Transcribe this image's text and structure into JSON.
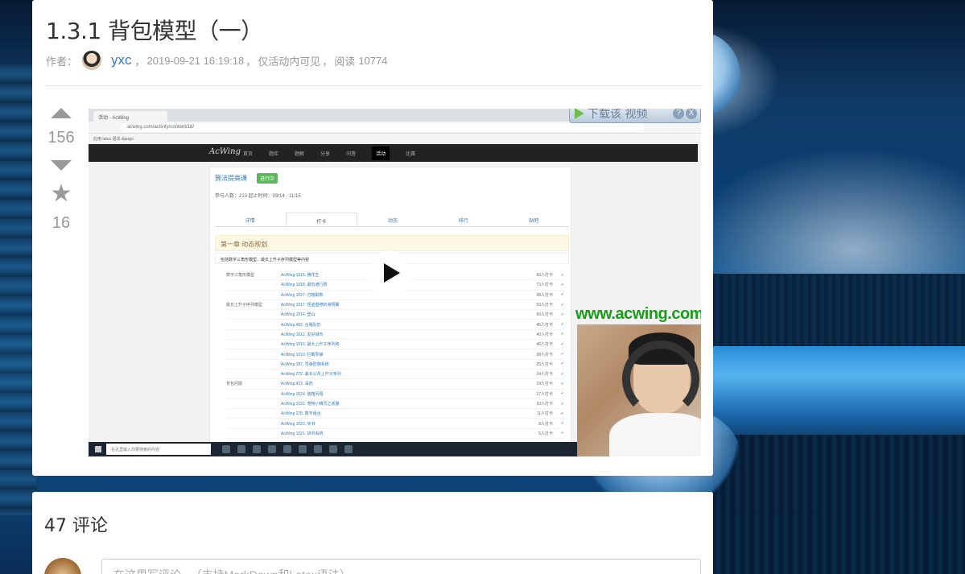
{
  "article": {
    "title": "1.3.1 背包模型（一）",
    "author_label": "作者：",
    "author_name": "yxc",
    "date": "2019-09-21 16:19:18",
    "visibility": "仅活动内可见",
    "read_label": "阅读",
    "read_count": "10774"
  },
  "votes": {
    "up_count": "156",
    "star_count": "16"
  },
  "video": {
    "browser_tab": "活动 - AcWing",
    "url": "acwing.com/activity/content/16/",
    "bookmarks": "应用   latex 语法   django",
    "site_logo": "AcWing",
    "nav_items": [
      "首页",
      "题库",
      "题解",
      "分享",
      "问答",
      "活动",
      "比赛"
    ],
    "nav_active": "活动",
    "course_title": "算法提高课",
    "course_status": "进行中",
    "course_info": "参与人数：213   起止时间：09/14 - 11/15",
    "tabs": [
      "详情",
      "打卡",
      "动态",
      "排行",
      "贴吧"
    ],
    "active_tab": "打卡",
    "chapter": "第一章 动态规划",
    "chapter_desc": "包括数字三角形模型、最长上升子序列模型等内容",
    "rows": [
      {
        "cat": "数字三角形模型",
        "name": "AcWing 1015. 摘花生",
        "cnt": "60人打卡"
      },
      {
        "cat": "",
        "name": "AcWing 1018. 最低通行费",
        "cnt": "73人打卡"
      },
      {
        "cat": "",
        "name": "AcWing 1027. 方格取数",
        "cnt": "58人打卡"
      },
      {
        "cat": "最长上升子序列模型",
        "name": "AcWing 1017. 怪盗基德的滑翔翼",
        "cnt": "53人打卡"
      },
      {
        "cat": "",
        "name": "AcWing 1014. 登山",
        "cnt": "50人打卡"
      },
      {
        "cat": "",
        "name": "AcWing 482. 合唱队形",
        "cnt": "45人打卡"
      },
      {
        "cat": "",
        "name": "AcWing 1012. 友好城市",
        "cnt": "40人打卡"
      },
      {
        "cat": "",
        "name": "AcWing 1016. 最大上升子序列和",
        "cnt": "46人打卡"
      },
      {
        "cat": "",
        "name": "AcWing 1010. 拦截导弹",
        "cnt": "38人打卡"
      },
      {
        "cat": "",
        "name": "AcWing 187. 导弹防御系统",
        "cnt": "25人打卡"
      },
      {
        "cat": "",
        "name": "AcWing 272. 最长公共上升子序列",
        "cnt": "24人打卡"
      },
      {
        "cat": "背包问题",
        "name": "AcWing 423. 采药",
        "cnt": "19人打卡"
      },
      {
        "cat": "",
        "name": "AcWing 1024. 装箱问题",
        "cnt": "17人打卡"
      },
      {
        "cat": "",
        "name": "AcWing 1022. 宠物小精灵之收服",
        "cnt": "10人打卡"
      },
      {
        "cat": "",
        "name": "AcWing 278. 数字组合",
        "cnt": "11人打卡"
      },
      {
        "cat": "",
        "name": "AcWing 1023. 买书",
        "cnt": "8人打卡"
      },
      {
        "cat": "",
        "name": "AcWing 1021. 货币系统",
        "cnt": "5人打卡"
      }
    ],
    "download_text": "下载该 视频",
    "help_glyph": "?",
    "close_glyph": "X",
    "watermark": "www.acwing.com",
    "taskbar_search": "在这里输入你要搜索的内容"
  },
  "comments": {
    "count": "47",
    "label": "评论",
    "placeholder": "在这里写评论...（支持MarkDown和Latex语法）"
  }
}
